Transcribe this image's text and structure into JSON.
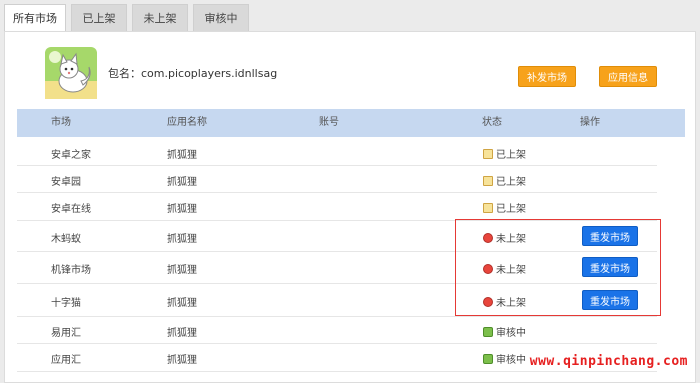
{
  "tabs": [
    {
      "label": "所有市场",
      "active": true
    },
    {
      "label": "已上架",
      "active": false
    },
    {
      "label": "未上架",
      "active": false
    },
    {
      "label": "审核中",
      "active": false
    }
  ],
  "app": {
    "package_label": "包名：com.picoplayers.idnllsag"
  },
  "buttons": {
    "supplement_market": "补发市场",
    "app_info": "应用信息"
  },
  "table": {
    "headers": {
      "market": "市场",
      "app_name": "应用名称",
      "account": "账号",
      "status": "状态",
      "action": "操作"
    },
    "rows": [
      {
        "market": "安卓之家",
        "app_name": "抓狐狸",
        "status": "已上架",
        "status_type": "listed",
        "action": ""
      },
      {
        "market": "安卓园",
        "app_name": "抓狐狸",
        "status": "已上架",
        "status_type": "listed",
        "action": ""
      },
      {
        "market": "安卓在线",
        "app_name": "抓狐狸",
        "status": "已上架",
        "status_type": "listed",
        "action": ""
      },
      {
        "market": "木蚂蚁",
        "app_name": "抓狐狸",
        "status": "未上架",
        "status_type": "unlisted",
        "action": "重发市场"
      },
      {
        "market": "机锋市场",
        "app_name": "抓狐狸",
        "status": "未上架",
        "status_type": "unlisted",
        "action": "重发市场"
      },
      {
        "market": "十字猫",
        "app_name": "抓狐狸",
        "status": "未上架",
        "status_type": "unlisted",
        "action": "重发市场"
      },
      {
        "market": "易用汇",
        "app_name": "抓狐狸",
        "status": "审核中",
        "status_type": "review",
        "action": ""
      },
      {
        "market": "应用汇",
        "app_name": "抓狐狸",
        "status": "审核中",
        "status_type": "review",
        "action": ""
      }
    ]
  },
  "watermark": "www.qinpinchang.com",
  "colors": {
    "header_bg": "#c6d8f0",
    "orange_button": "#f7a21b",
    "blue_button": "#1a73e8",
    "highlight_box": "#e53935",
    "watermark": "#e62020"
  }
}
